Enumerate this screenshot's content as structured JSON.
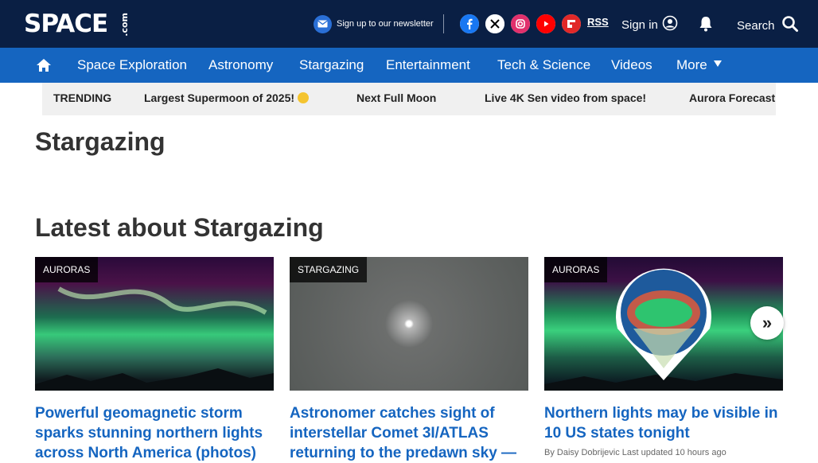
{
  "header": {
    "logo": "SPACE",
    "logo_suffix": ".com",
    "newsletter": "Sign up to our newsletter",
    "rss": "RSS",
    "signin": "Sign in",
    "search": "Search"
  },
  "nav": {
    "items": [
      "Space Exploration",
      "Astronomy",
      "Stargazing",
      "Entertainment",
      "Tech & Science",
      "Videos"
    ],
    "more": "More"
  },
  "trending": {
    "label": "TRENDING",
    "items": [
      "Largest Supermoon of 2025!",
      "Next Full Moon",
      "Live 4K Sen video from space!",
      "Aurora Forecast"
    ]
  },
  "page": {
    "title": "Stargazing",
    "section_title": "Latest about Stargazing"
  },
  "cards": [
    {
      "tag": "AURORAS",
      "headline": "Powerful geomagnetic storm sparks stunning northern lights across North America (photos)",
      "byline": ""
    },
    {
      "tag": "STARGAZING",
      "headline": "Astronomer catches sight of interstellar Comet 3I/ATLAS returning to the predawn sky —",
      "byline": ""
    },
    {
      "tag": "AURORAS",
      "headline": "Northern lights may be visible in 10 US states tonight",
      "byline": "By Daisy Dobrijevic Last updated 10 hours ago"
    }
  ],
  "colors": {
    "topbar": "#0a1f44",
    "navbar": "#1565c0",
    "headline": "#1565c0"
  }
}
